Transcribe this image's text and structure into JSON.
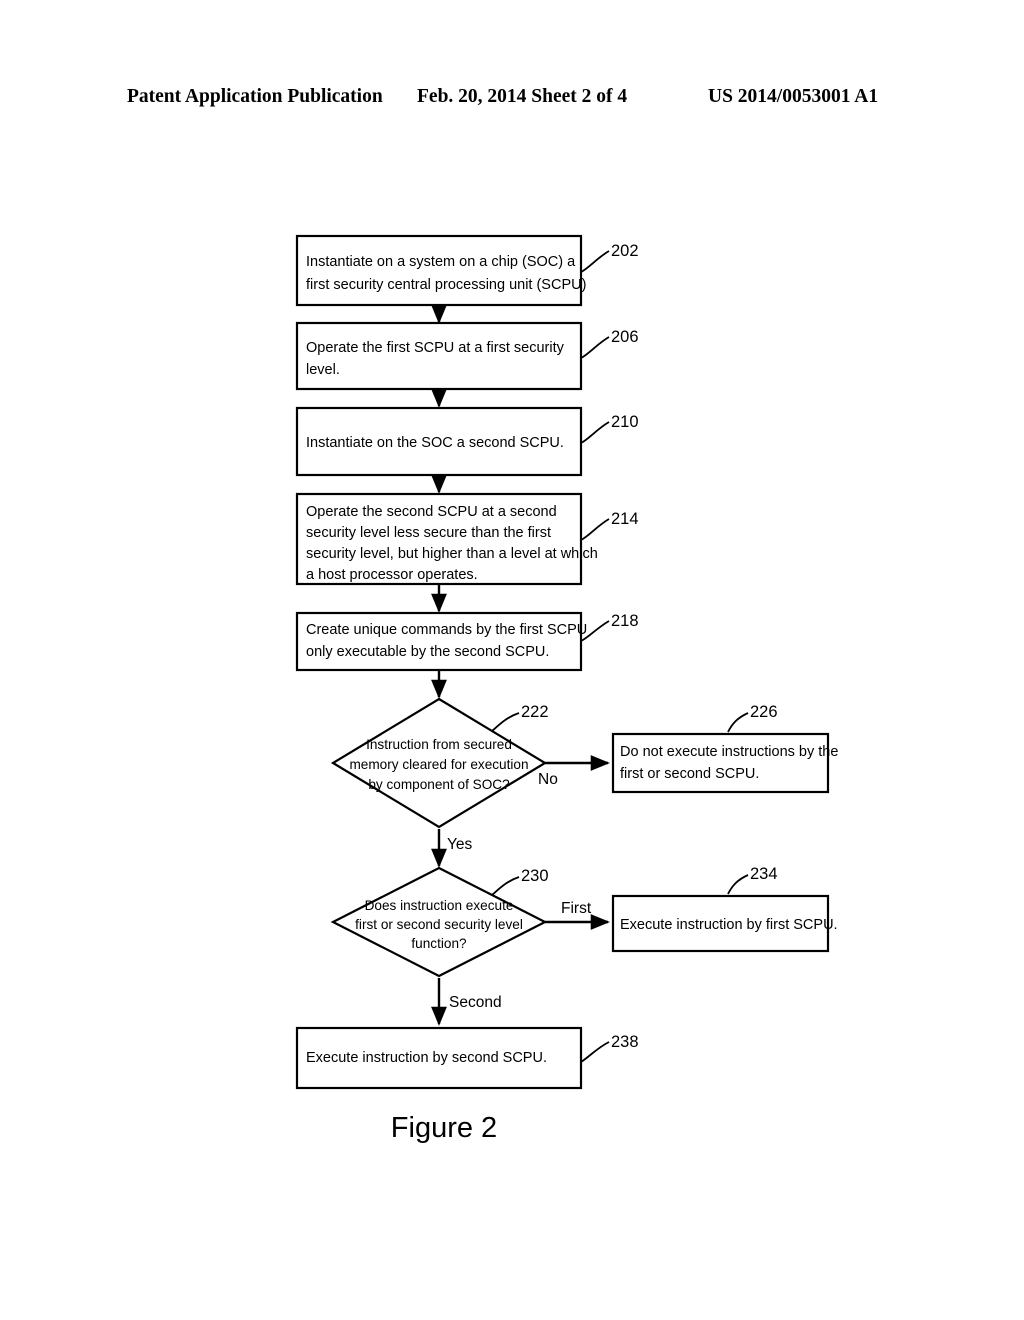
{
  "header": {
    "left": "Patent Application Publication",
    "middle": "Feb. 20, 2014  Sheet 2 of 4",
    "right": "US 2014/0053001 A1"
  },
  "figure": {
    "caption": "Figure 2"
  },
  "flowchart": {
    "nodes": [
      {
        "id": "202",
        "ref": "202",
        "shape": "process",
        "lines": [
          "Instantiate on a system on a chip (SOC) a",
          "first security central processing unit (SCPU)"
        ]
      },
      {
        "id": "206",
        "ref": "206",
        "shape": "process",
        "lines": [
          "Operate the first SCPU at a first security",
          "level."
        ]
      },
      {
        "id": "210",
        "ref": "210",
        "shape": "process",
        "lines": [
          "Instantiate on the SOC a second SCPU."
        ]
      },
      {
        "id": "214",
        "ref": "214",
        "shape": "process",
        "lines": [
          "Operate the second SCPU at a second",
          "security level less secure than the first",
          "security level, but higher than a level at which",
          "a host processor operates."
        ]
      },
      {
        "id": "218",
        "ref": "218",
        "shape": "process",
        "lines": [
          "Create unique commands by the first SCPU",
          "only executable by the second SCPU."
        ]
      },
      {
        "id": "222",
        "ref": "222",
        "shape": "decision",
        "lines": [
          "Instruction from secured",
          "memory cleared for execution",
          "by component of SOC?"
        ]
      },
      {
        "id": "226",
        "ref": "226",
        "shape": "process",
        "lines": [
          "Do not execute instructions by the",
          "first or second SCPU."
        ]
      },
      {
        "id": "230",
        "ref": "230",
        "shape": "decision",
        "lines": [
          "Does instruction execute",
          "first or second security level",
          "function?"
        ]
      },
      {
        "id": "234",
        "ref": "234",
        "shape": "process",
        "lines": [
          "Execute instruction by first SCPU."
        ]
      },
      {
        "id": "238",
        "ref": "238",
        "shape": "process",
        "lines": [
          "Execute instruction by second SCPU."
        ]
      }
    ],
    "branch_labels": {
      "no": "No",
      "yes": "Yes",
      "first": "First",
      "second": "Second"
    }
  },
  "colors": {
    "ink": "#000000",
    "paper": "#ffffff"
  }
}
